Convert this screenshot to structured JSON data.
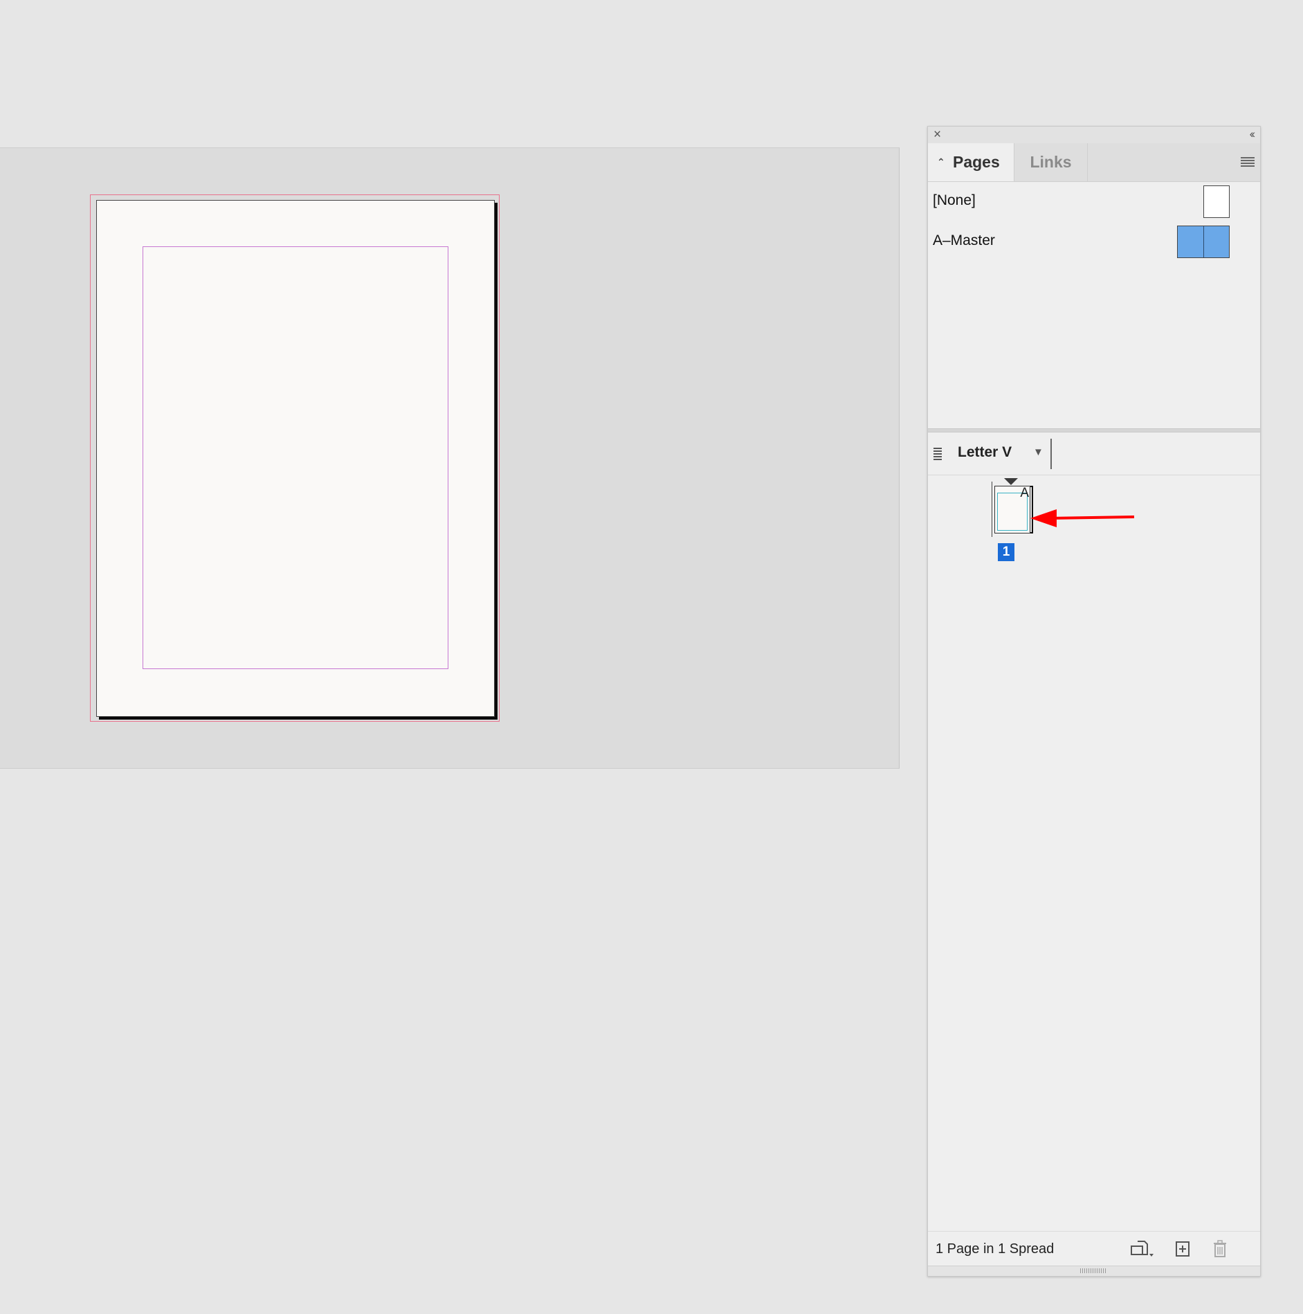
{
  "panel": {
    "tabs": [
      {
        "label": "Pages",
        "active": true
      },
      {
        "label": "Links",
        "active": false
      }
    ],
    "masters": [
      {
        "label": "[None]"
      },
      {
        "label": "A–Master"
      }
    ],
    "view": {
      "page_size": "Letter V"
    },
    "pages": [
      {
        "number": "1",
        "master_prefix": "A",
        "selected": true
      }
    ],
    "footer": {
      "status": "1 Page in 1 Spread"
    },
    "icons": {
      "close": "close-icon",
      "collapse": "collapse-icon",
      "menu": "panel-menu-icon",
      "edit_page_size": "edit-page-size-icon",
      "new_page": "new-page-icon",
      "delete": "trash-icon"
    }
  },
  "colors": {
    "bleed_guide": "#e8728c",
    "margin_guide": "#c678d2",
    "selection": "#1a6bd6",
    "master_thumb": "#6aa8e8",
    "annotation_arrow": "#ff0000"
  }
}
